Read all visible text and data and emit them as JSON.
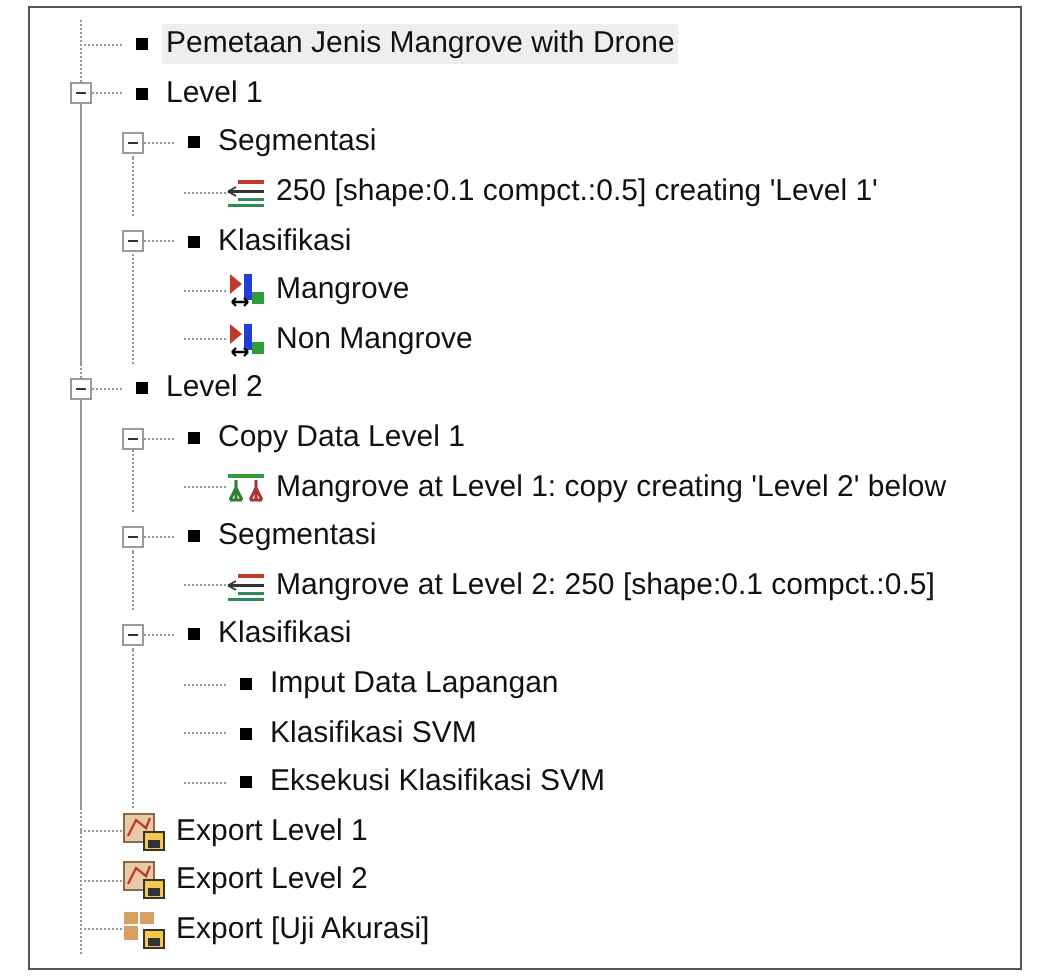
{
  "tree": [
    {
      "label": "Pemetaan Jenis Mangrove with Drone",
      "kind": "bullet",
      "selected": true
    },
    {
      "label": "Level 1",
      "kind": "bullet",
      "selected": false,
      "expanded": true,
      "children": [
        {
          "label": "Segmentasi",
          "kind": "bullet",
          "selected": false,
          "expanded": true,
          "children": [
            {
              "label": "250 [shape:0.1 compct.:0.5] creating 'Level 1'",
              "kind": "segmentation",
              "selected": false
            }
          ]
        },
        {
          "label": "Klasifikasi",
          "kind": "bullet",
          "selected": false,
          "expanded": true,
          "children": [
            {
              "label": "Mangrove",
              "kind": "classification",
              "selected": false
            },
            {
              "label": "Non Mangrove",
              "kind": "classification",
              "selected": false
            }
          ]
        }
      ]
    },
    {
      "label": "Level 2",
      "kind": "bullet",
      "selected": false,
      "expanded": true,
      "children": [
        {
          "label": "Copy Data Level 1",
          "kind": "bullet",
          "selected": false,
          "expanded": true,
          "children": [
            {
              "label": "Mangrove at  Level 1: copy creating 'Level 2' below",
              "kind": "copy",
              "selected": false
            }
          ]
        },
        {
          "label": "Segmentasi",
          "kind": "bullet",
          "selected": false,
          "expanded": true,
          "children": [
            {
              "label": "Mangrove at  Level 2: 250 [shape:0.1 compct.:0.5]",
              "kind": "segmentation",
              "selected": false
            }
          ]
        },
        {
          "label": "Klasifikasi",
          "kind": "bullet",
          "selected": false,
          "expanded": true,
          "children": [
            {
              "label": "Imput Data Lapangan",
              "kind": "bullet",
              "selected": false
            },
            {
              "label": "Klasifikasi SVM",
              "kind": "bullet",
              "selected": false
            },
            {
              "label": "Eksekusi Klasifikasi SVM",
              "kind": "bullet",
              "selected": false
            }
          ]
        }
      ]
    },
    {
      "label": "Export Level 1",
      "kind": "export-map",
      "selected": false
    },
    {
      "label": "Export Level 2",
      "kind": "export-map",
      "selected": false
    },
    {
      "label": "Export [Uji Akurasi]",
      "kind": "export-grid",
      "selected": false
    }
  ]
}
